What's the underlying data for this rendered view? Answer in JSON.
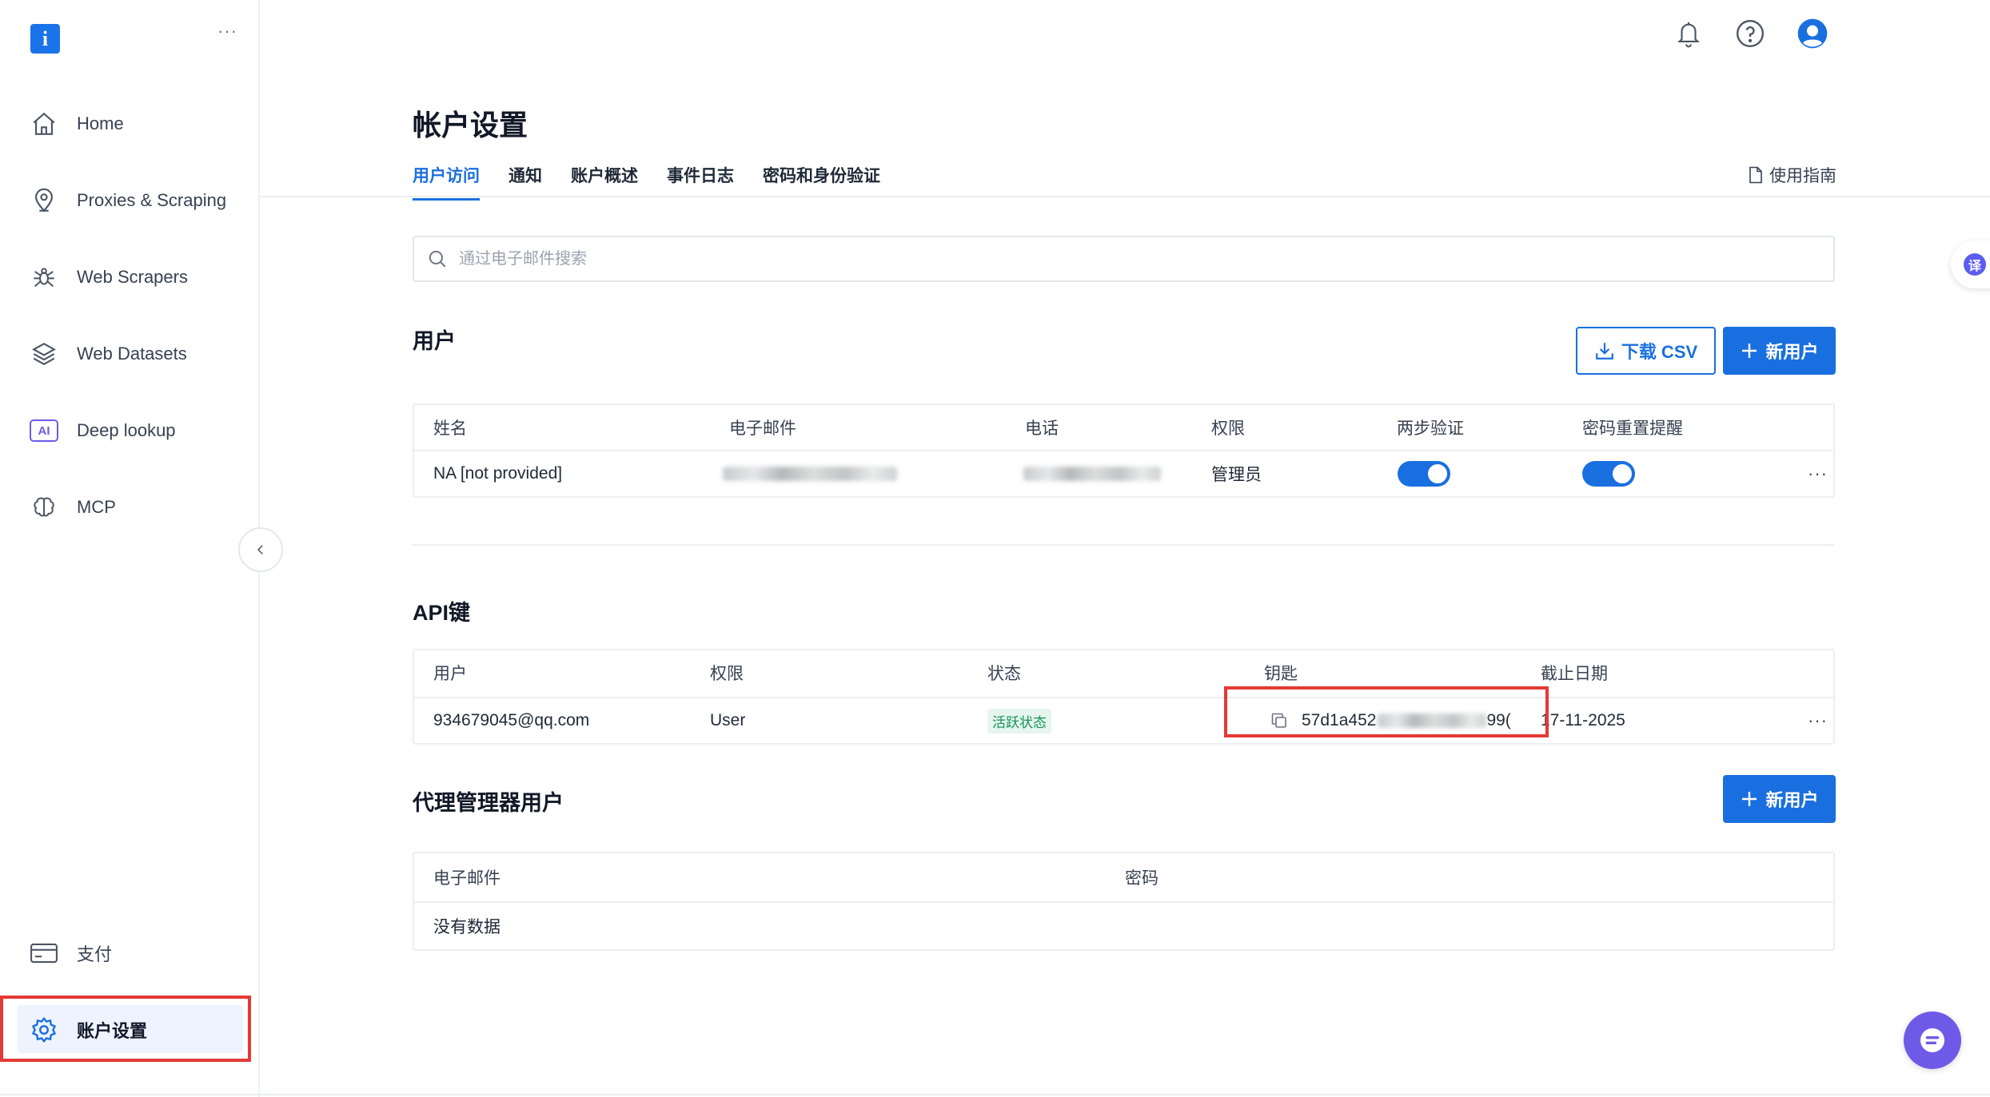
{
  "app": {
    "logo_letter": "i",
    "menu_dots": "···"
  },
  "sidebar": {
    "items": [
      {
        "label": "Home",
        "icon": "home-icon"
      },
      {
        "label": "Proxies & Scraping",
        "icon": "location-pin-icon"
      },
      {
        "label": "Web Scrapers",
        "icon": "spider-icon"
      },
      {
        "label": "Web Datasets",
        "icon": "layers-icon"
      },
      {
        "label": "Deep lookup",
        "icon": "ai-badge-icon",
        "icon_text": "AI"
      },
      {
        "label": "MCP",
        "icon": "brain-icon"
      }
    ],
    "payment": {
      "label": "支付",
      "icon": "credit-card-icon"
    },
    "account": {
      "label": "账户设置",
      "icon": "gear-icon",
      "active": true
    }
  },
  "header": {
    "icons": [
      "bell-icon",
      "help-icon",
      "user-avatar-icon"
    ]
  },
  "page": {
    "title": "帐户设置",
    "tabs": [
      "用户访问",
      "通知",
      "账户概述",
      "事件日志",
      "密码和身份验证"
    ],
    "active_tab": 0,
    "guide_label": "使用指南"
  },
  "search": {
    "placeholder": "通过电子邮件搜索",
    "value": ""
  },
  "users": {
    "title": "用户",
    "download_label": "下载 CSV",
    "new_label": "新用户",
    "columns": [
      "姓名",
      "电子邮件",
      "电话",
      "权限",
      "两步验证",
      "密码重置提醒"
    ],
    "rows": [
      {
        "name": "NA [not provided]",
        "permission": "管理员",
        "two_step": true,
        "reset_reminder": true
      }
    ]
  },
  "api_keys": {
    "title": "API键",
    "columns": [
      "用户",
      "权限",
      "状态",
      "钥匙",
      "截止日期"
    ],
    "rows": [
      {
        "user": "934679045@qq.com",
        "permission": "User",
        "status": "活跃状态",
        "key_prefix": "57d1a452",
        "key_suffix": "99(",
        "expiry": "17-11-2025"
      }
    ]
  },
  "proxy_users": {
    "title": "代理管理器用户",
    "new_label": "新用户",
    "columns": [
      "电子邮件",
      "密码"
    ],
    "empty_text": "没有数据"
  },
  "floating": {
    "translate_label": "译"
  },
  "colors": {
    "primary": "#1a6fe0",
    "highlight": "#e53935",
    "status_green": "#17935a",
    "chat": "#6f5ae8"
  }
}
